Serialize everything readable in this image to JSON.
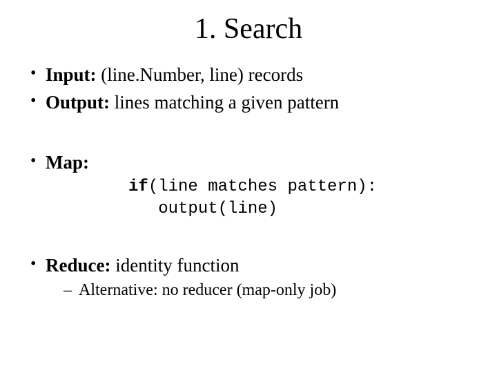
{
  "title": "1. Search",
  "bullets": {
    "input": {
      "label": "Input:",
      "text": " (line.Number, line) records"
    },
    "output": {
      "label": "Output:",
      "text": " lines matching a given pattern"
    },
    "map": {
      "label": "Map:",
      "code_kw": "if",
      "code_rest_line1": "(line matches pattern):",
      "code_line2": "   output(line)"
    },
    "reduce": {
      "label": "Reduce:",
      "text": " identity function",
      "alt": "Alternative: no reducer (map-only job)"
    }
  }
}
